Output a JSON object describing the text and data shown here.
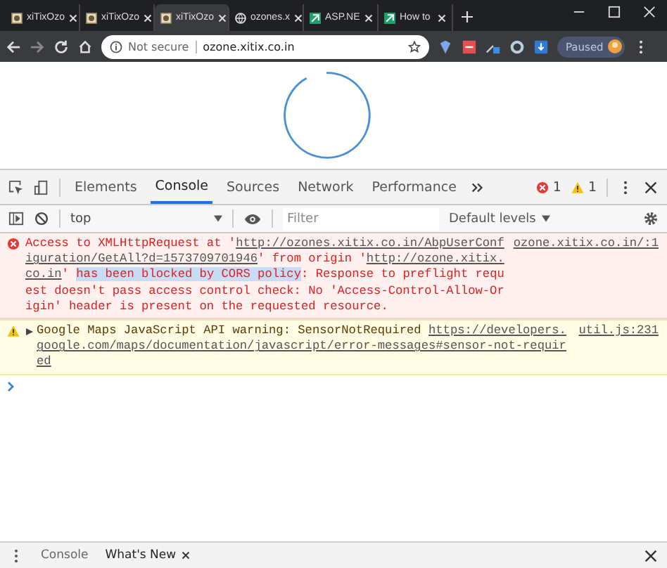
{
  "browser": {
    "tabs": [
      {
        "title": "xiTixOzo",
        "kind": "site",
        "selected": false
      },
      {
        "title": "xiTixOzo",
        "kind": "site",
        "selected": false
      },
      {
        "title": "xiTixOzo",
        "kind": "site",
        "selected": true
      },
      {
        "title": "ozones.x",
        "kind": "globe",
        "selected": false
      },
      {
        "title": "ASP.NE",
        "kind": "app",
        "selected": false
      },
      {
        "title": "How to",
        "kind": "app",
        "selected": false
      }
    ],
    "address": {
      "security": "Not secure",
      "url": "ozone.xitix.co.in"
    },
    "profile": {
      "label": "Paused"
    }
  },
  "devtools": {
    "tabs": [
      {
        "label": "Elements",
        "selected": false
      },
      {
        "label": "Console",
        "selected": true
      },
      {
        "label": "Sources",
        "selected": false
      },
      {
        "label": "Network",
        "selected": false
      },
      {
        "label": "Performance",
        "selected": false
      }
    ],
    "error_count": "1",
    "warning_count": "1",
    "context": "top",
    "filter": {
      "placeholder": "Filter"
    },
    "levels": "Default levels",
    "messages": [
      {
        "kind": "error",
        "source": "ozone.xitix.co.in/:1",
        "segments": [
          {
            "kind": "plain",
            "text": "Access to XMLHttpRequest at '"
          },
          {
            "kind": "link",
            "text": "http://ozones.xitix.co.in/AbpUserConfiguration/GetAll?d=1573709701946"
          },
          {
            "kind": "plain",
            "text": "' from origin '"
          },
          {
            "kind": "link",
            "text": "http://ozone.xitix.co.in"
          },
          {
            "kind": "plain",
            "text": "' "
          },
          {
            "kind": "selected",
            "text": "has been blocked by CORS policy"
          },
          {
            "kind": "plain",
            "text": ": Response to preflight request doesn't pass access control check: No 'Access-Control-Allow-Origin' header is present on the requested resource."
          }
        ]
      },
      {
        "kind": "warning",
        "source": "util.js:231",
        "segments": [
          {
            "kind": "plain",
            "text": "Google Maps JavaScript API warning: SensorNotRequired "
          },
          {
            "kind": "link",
            "text": "https://developers.google.com/maps/documentation/javascript/error-messages#sensor-not-required"
          }
        ]
      }
    ],
    "drawer": {
      "tabs": [
        {
          "label": "Console",
          "selected": false,
          "closable": false
        },
        {
          "label": "What's New",
          "selected": true,
          "closable": true
        }
      ]
    }
  }
}
